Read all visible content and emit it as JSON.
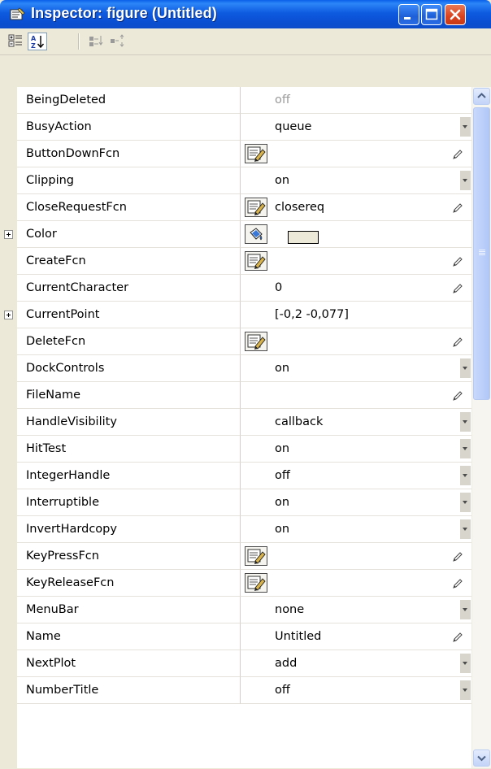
{
  "window": {
    "title": "Inspector:  figure (Untitled)",
    "title_color": "#FFFFFF",
    "titlebar_color": "#0A5FE8"
  },
  "toolbar": {
    "buttons": [
      {
        "icon": "categorized-view-icon",
        "pressed": false
      },
      {
        "icon": "alphabetical-sort-icon",
        "pressed": true
      },
      {
        "icon": "expand-all-icon",
        "pressed": false
      },
      {
        "icon": "collapse-all-icon",
        "pressed": false
      }
    ]
  },
  "properties": [
    {
      "name": "BeingDeleted",
      "value": "off",
      "dim": true,
      "expand": false,
      "icon": "",
      "editor": "none"
    },
    {
      "name": "BusyAction",
      "value": "queue",
      "expand": false,
      "icon": "",
      "editor": "dropdown"
    },
    {
      "name": "ButtonDownFcn",
      "value": "",
      "expand": false,
      "icon": "callback-editor-icon",
      "editor": "pencil"
    },
    {
      "name": "Clipping",
      "value": "on",
      "expand": false,
      "icon": "",
      "editor": "dropdown"
    },
    {
      "name": "CloseRequestFcn",
      "value": "closereq",
      "expand": false,
      "icon": "callback-editor-icon",
      "editor": "pencil"
    },
    {
      "name": "Color",
      "value": "",
      "expand": true,
      "icon": "color-picker-icon",
      "editor": "swatch",
      "swatch_color": "#ECE9D8"
    },
    {
      "name": "CreateFcn",
      "value": "",
      "expand": false,
      "icon": "callback-editor-icon",
      "editor": "pencil"
    },
    {
      "name": "CurrentCharacter",
      "value": "0",
      "expand": false,
      "icon": "",
      "editor": "pencil"
    },
    {
      "name": "CurrentPoint",
      "value": "[-0,2 -0,077]",
      "expand": true,
      "icon": "",
      "editor": "none"
    },
    {
      "name": "DeleteFcn",
      "value": "",
      "expand": false,
      "icon": "callback-editor-icon",
      "editor": "pencil"
    },
    {
      "name": "DockControls",
      "value": "on",
      "expand": false,
      "icon": "",
      "editor": "dropdown"
    },
    {
      "name": "FileName",
      "value": "",
      "expand": false,
      "icon": "",
      "editor": "pencil"
    },
    {
      "name": "HandleVisibility",
      "value": "callback",
      "expand": false,
      "icon": "",
      "editor": "dropdown"
    },
    {
      "name": "HitTest",
      "value": "on",
      "expand": false,
      "icon": "",
      "editor": "dropdown"
    },
    {
      "name": "IntegerHandle",
      "value": "off",
      "expand": false,
      "icon": "",
      "editor": "dropdown"
    },
    {
      "name": "Interruptible",
      "value": "on",
      "expand": false,
      "icon": "",
      "editor": "dropdown"
    },
    {
      "name": "InvertHardcopy",
      "value": "on",
      "expand": false,
      "icon": "",
      "editor": "dropdown"
    },
    {
      "name": "KeyPressFcn",
      "value": "",
      "expand": false,
      "icon": "callback-editor-icon",
      "editor": "pencil"
    },
    {
      "name": "KeyReleaseFcn",
      "value": "",
      "expand": false,
      "icon": "callback-editor-icon",
      "editor": "pencil"
    },
    {
      "name": "MenuBar",
      "value": "none",
      "expand": false,
      "icon": "",
      "editor": "dropdown"
    },
    {
      "name": "Name",
      "value": "Untitled",
      "expand": false,
      "icon": "",
      "editor": "pencil"
    },
    {
      "name": "NextPlot",
      "value": "add",
      "expand": false,
      "icon": "",
      "editor": "dropdown"
    },
    {
      "name": "NumberTitle",
      "value": "off",
      "expand": false,
      "icon": "",
      "editor": "dropdown"
    }
  ],
  "scrollbar": {
    "position": 0.0,
    "visible_fraction": 0.43
  }
}
